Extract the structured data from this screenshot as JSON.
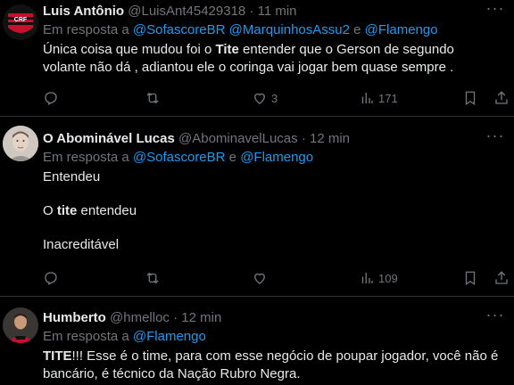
{
  "tweets": [
    {
      "name": "Luis Antônio",
      "handle": "@LuisAnt45429318",
      "separator": "·",
      "time": "11 min",
      "reply_prefix": "Em resposta a",
      "reply_mentions": [
        "@SofascoreBR",
        "@MarquinhosAssu2",
        "@Flamengo"
      ],
      "reply_joiner": "e",
      "text_line1_a": "Única coisa que mudou foi o ",
      "text_line1_bold": "Tite",
      "text_line1_b": " entender que o Gerson de segundo",
      "text_line2": "volante não dá , adiantou ele o coringa vai jogar bem quase sempre .",
      "likes": "3",
      "views": "171",
      "avatar_colors": [
        "#c8102e",
        "#111111"
      ]
    },
    {
      "name": "O Abominável Lucas",
      "handle": "@AbominavelLucas",
      "separator": "·",
      "time": "12 min",
      "reply_prefix": "Em resposta a",
      "reply_mentions": [
        "@SofascoreBR",
        "@Flamengo"
      ],
      "reply_joiner": "e",
      "para1": "Entendeu",
      "para2_a": "O ",
      "para2_bold": "tite",
      "para2_b": " entendeu",
      "para3": "Inacreditável",
      "likes": "",
      "views": "109"
    },
    {
      "name": "Humberto",
      "handle": "@hmelloc",
      "separator": "·",
      "time": "12 min",
      "reply_prefix": "Em resposta a",
      "reply_mentions": [
        "@Flamengo"
      ],
      "text_bold": "TITE",
      "text_a": "!!! Esse é o time, para com esse negócio de poupar jogador, você não é bancário, é técnico da Nação Rubro Negra."
    }
  ],
  "icons": {
    "more": "more-horizontal-icon",
    "reply": "reply-icon",
    "retweet": "retweet-icon",
    "like": "heart-icon",
    "views": "analytics-icon",
    "bookmark": "bookmark-icon",
    "share": "share-icon"
  }
}
